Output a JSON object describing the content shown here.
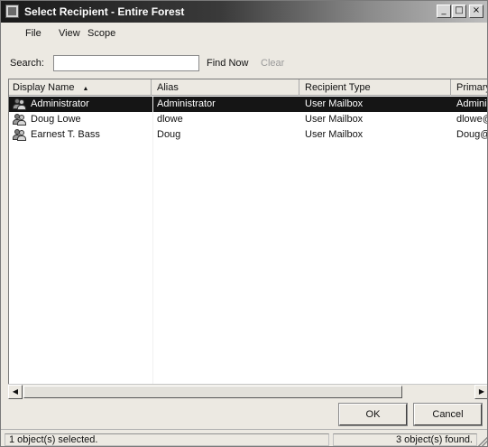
{
  "window": {
    "title": "Select Recipient - Entire Forest",
    "buttons": {
      "minimize": "_",
      "maximize": "□",
      "close": "×"
    }
  },
  "menu": [
    "File",
    "View",
    "Scope"
  ],
  "search": {
    "label": "Search:",
    "value": "",
    "placeholder": "",
    "find_now": "Find Now",
    "clear": "Clear"
  },
  "list": {
    "columns": [
      "Display Name",
      "Alias",
      "Recipient Type",
      "Primary"
    ],
    "sort_indicator": "▲",
    "rows": [
      {
        "name": "Administrator",
        "alias": "Administrator",
        "type": "User Mailbox",
        "primary": "Admini",
        "selected": true
      },
      {
        "name": "Doug Lowe",
        "alias": "dlowe",
        "type": "User Mailbox",
        "primary": "dlowe@",
        "selected": false
      },
      {
        "name": "Earnest T. Bass",
        "alias": "Doug",
        "type": "User Mailbox",
        "primary": "Doug@",
        "selected": false
      }
    ]
  },
  "buttons": {
    "ok": "OK",
    "cancel": "Cancel"
  },
  "status": {
    "left": "1 object(s) selected.",
    "right": "3 object(s) found."
  },
  "colors": {
    "selection": "#151515",
    "title_start": "#1a1a1a",
    "title_end": "#bdbdbd"
  }
}
